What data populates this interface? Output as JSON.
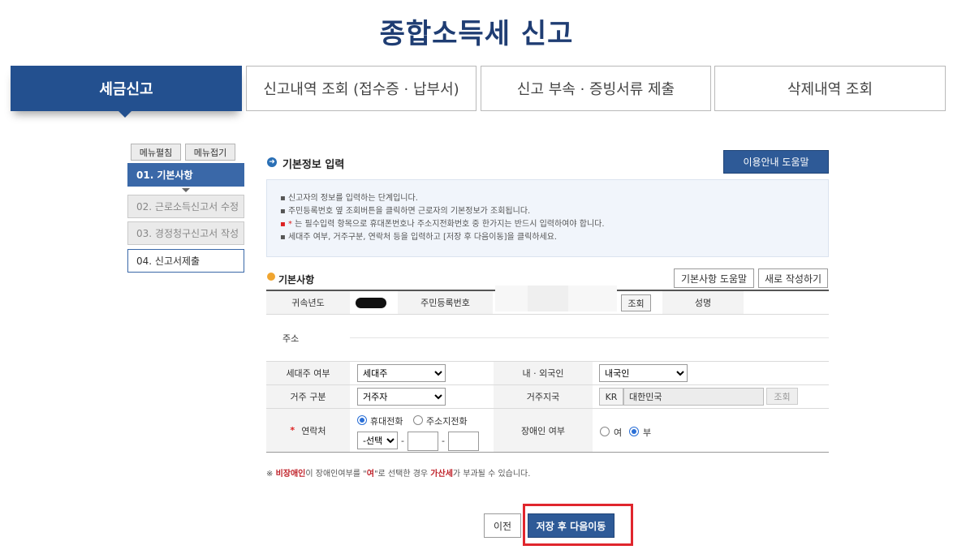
{
  "page": {
    "title": "종합소득세 신고"
  },
  "tabs": [
    {
      "label": "세금신고",
      "active": true
    },
    {
      "label": "신고내역 조회 (접수증 · 납부서)"
    },
    {
      "label": "신고 부속 · 증빙서류 제출"
    },
    {
      "label": "삭제내역 조회"
    }
  ],
  "menu_controls": {
    "expand": "메뉴펼침",
    "collapse": "메뉴접기"
  },
  "steps": [
    {
      "label": "01. 기본사항",
      "state": "active"
    },
    {
      "label": "02. 근로소득신고서 수정",
      "state": "disabled"
    },
    {
      "label": "03. 경정청구신고서 작성",
      "state": "disabled"
    },
    {
      "label": "04. 신고서제출",
      "state": "normal"
    }
  ],
  "section": {
    "title": "기본정보 입력",
    "help_button": "이용안내 도움말"
  },
  "guide": {
    "lines": [
      "▪ 신고자의 정보를 입력하는 단계입니다.",
      "▪ 주민등록번호 옆 조회버튼을 클릭하면 근로자의 기본정보가 조회됩니다.",
      "는 필수입력 항목으로 휴대폰번호나 주소지전화번호 중 한가지는 반드시 입력하여야 합니다.",
      "▪ 세대주 여부, 거주구분, 연락처 등을 입력하고 [저장 후 다음이동]을 클릭하세요."
    ],
    "star_prefix": "▪ * "
  },
  "basic": {
    "title": "기본사항",
    "help_button": "기본사항 도움말",
    "new_button": "새로 작성하기"
  },
  "form": {
    "year_label": "귀속년도",
    "rrn_label": "주민등록번호",
    "lookup_button": "조회",
    "name_label": "성명",
    "address_label": "주소",
    "householder_label": "세대주 여부",
    "householder_value": "세대주",
    "nationality_label": "내 · 외국인",
    "nationality_value": "내국인",
    "residence_label": "거주 구분",
    "residence_value": "거주자",
    "country_label": "거주지국",
    "country_code": "KR",
    "country_name": "대한민국",
    "country_lookup": "조회",
    "contact_label": "연락처",
    "contact_required": "*",
    "contact_mobile": "휴대전화",
    "contact_home": "주소지전화",
    "contact_select": "-선택",
    "contact_dash": "-",
    "disabled_label": "장애인 여부",
    "disabled_yes": "여",
    "disabled_no": "부"
  },
  "notice": {
    "mark": "※",
    "red1": "비장애인",
    "t1": "이 장애인여부를 \"",
    "red2": "여",
    "t2": "\"로 선택한 경우 ",
    "red3": "가산세",
    "t3": "가 부과될 수 있습니다."
  },
  "footer": {
    "prev": "이전",
    "save_next": "저장 후 다음이동"
  },
  "colors": {
    "primary": "#23508f",
    "highlight": "#e0262d"
  }
}
